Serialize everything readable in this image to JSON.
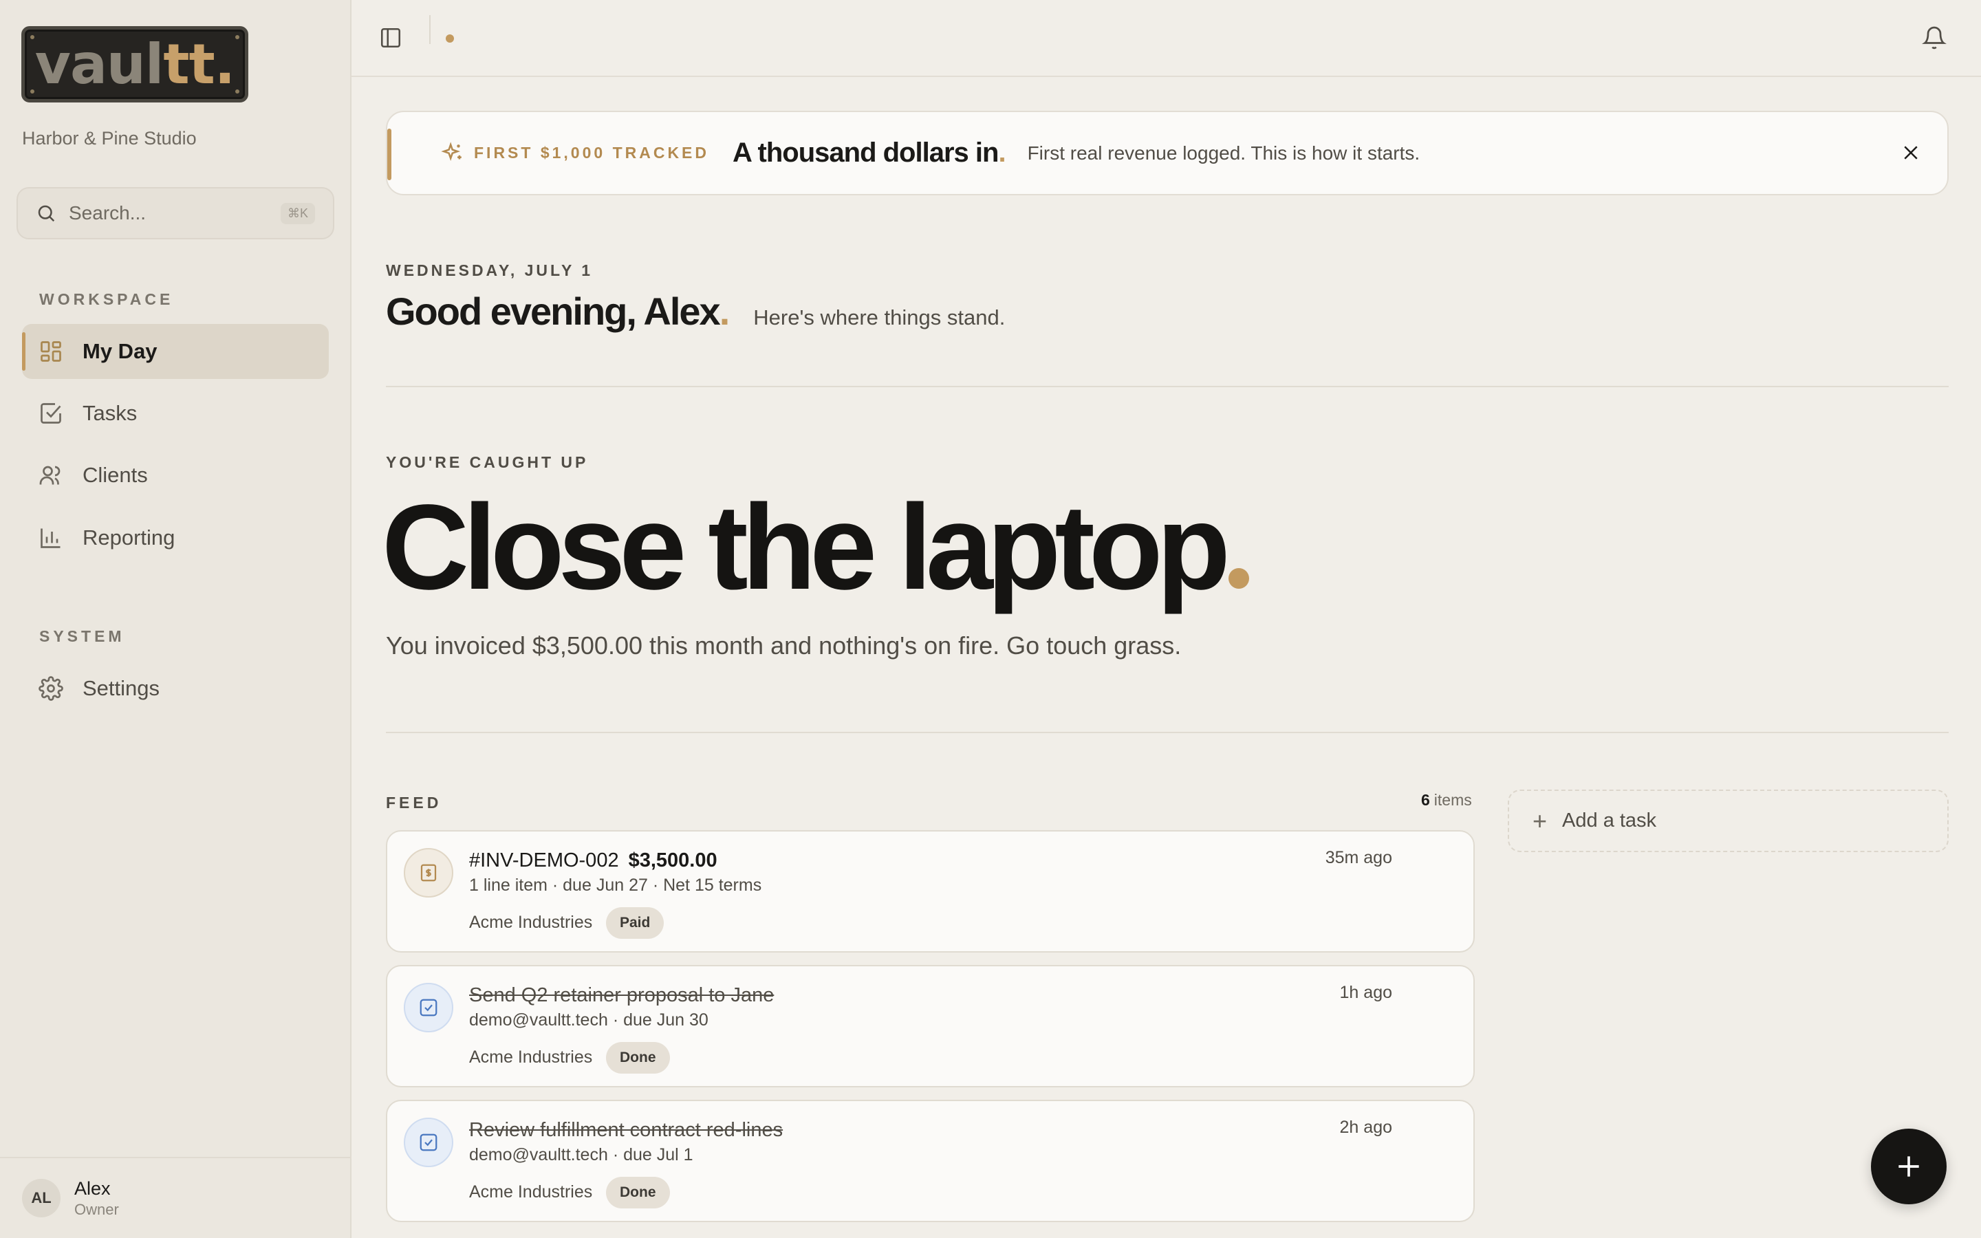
{
  "sidebar": {
    "logo": "vaultt.",
    "studio": "Harbor & Pine Studio",
    "search": {
      "placeholder": "Search...",
      "shortcut": "⌘K"
    },
    "sections": {
      "workspace": "WORKSPACE",
      "system": "SYSTEM"
    },
    "items": [
      {
        "label": "My Day",
        "icon": "grid-icon",
        "active": true
      },
      {
        "label": "Tasks",
        "icon": "checkbox-icon"
      },
      {
        "label": "Clients",
        "icon": "users-icon"
      },
      {
        "label": "Reporting",
        "icon": "bar-chart-icon"
      },
      {
        "label": "Settings",
        "icon": "gear-icon"
      }
    ],
    "user": {
      "initials": "AL",
      "name": "Alex",
      "role": "Owner"
    }
  },
  "banner": {
    "tag": "FIRST $1,000 TRACKED",
    "title": "A thousand dollars in",
    "title_accent": ".",
    "subtitle": "First real revenue logged. This is how it starts."
  },
  "greeting": {
    "date": "WEDNESDAY, JULY 1",
    "title": "Good evening, Alex",
    "title_accent": ".",
    "subtitle": "Here's where things stand."
  },
  "status": {
    "label": "YOU'RE CAUGHT UP",
    "headline": "Close the laptop",
    "message": "You invoiced $3,500.00 this month and nothing's on fire. Go touch grass."
  },
  "feed": {
    "label": "FEED",
    "count": "6",
    "count_unit": "items",
    "items": [
      {
        "title": "#INV-DEMO-002",
        "amount": "$3,500.00",
        "meta": "1 line item · due Jun 27 · Net 15 terms",
        "client": "Acme Industries",
        "badge": "Paid",
        "time": "35m ago",
        "type": "invoice"
      },
      {
        "title": "Send Q2 retainer proposal to Jane",
        "meta": "demo@vaultt.tech · due Jun 30",
        "client": "Acme Industries",
        "badge": "Done",
        "time": "1h ago",
        "type": "task"
      },
      {
        "title": "Review fulfillment contract red-lines",
        "meta": "demo@vaultt.tech · due Jul 1",
        "client": "Acme Industries",
        "badge": "Done",
        "time": "2h ago",
        "type": "task"
      }
    ]
  },
  "add_task": {
    "label": "Add a task"
  },
  "colors": {
    "accent": "#c39a5f",
    "background": "#f1eee8",
    "sidebar": "#ebe7df"
  }
}
